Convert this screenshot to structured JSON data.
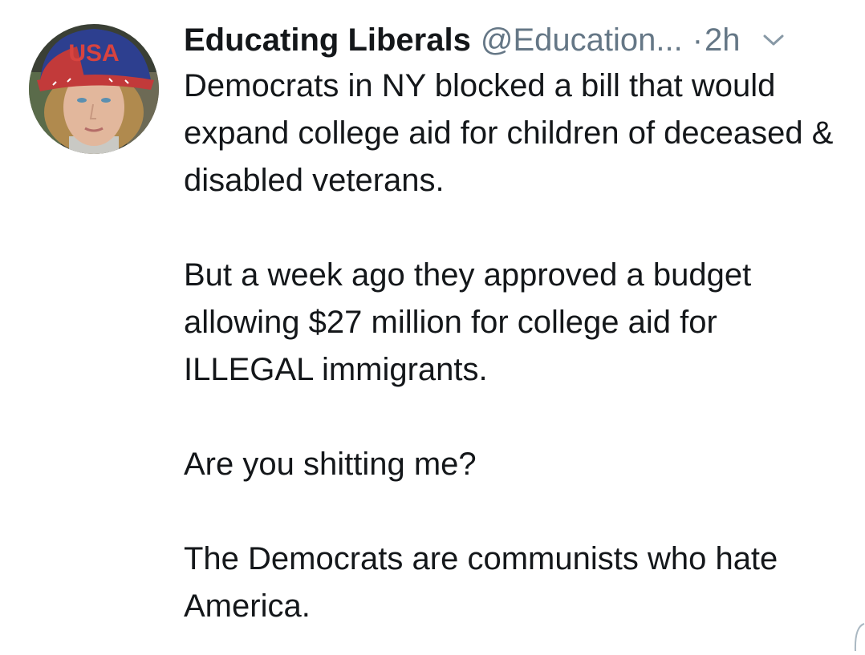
{
  "tweet": {
    "display_name": "Educating Liberals",
    "handle": "@Education...",
    "separator": "·",
    "time": "2h",
    "paragraphs": [
      "Democrats in NY blocked a bill that would expand college aid for children of deceased & disabled veterans.",
      "But a week ago they approved a budget allowing $27 million for college aid for ILLEGAL immigrants.",
      "Are you shitting me?",
      "The Democrats are communists who hate America."
    ],
    "avatar_hat_text": "USA"
  },
  "icons": {
    "menu": "chevron-down-icon"
  },
  "colors": {
    "name": "#14171a",
    "secondary": "#657786",
    "text": "#14171a",
    "background": "#ffffff"
  }
}
